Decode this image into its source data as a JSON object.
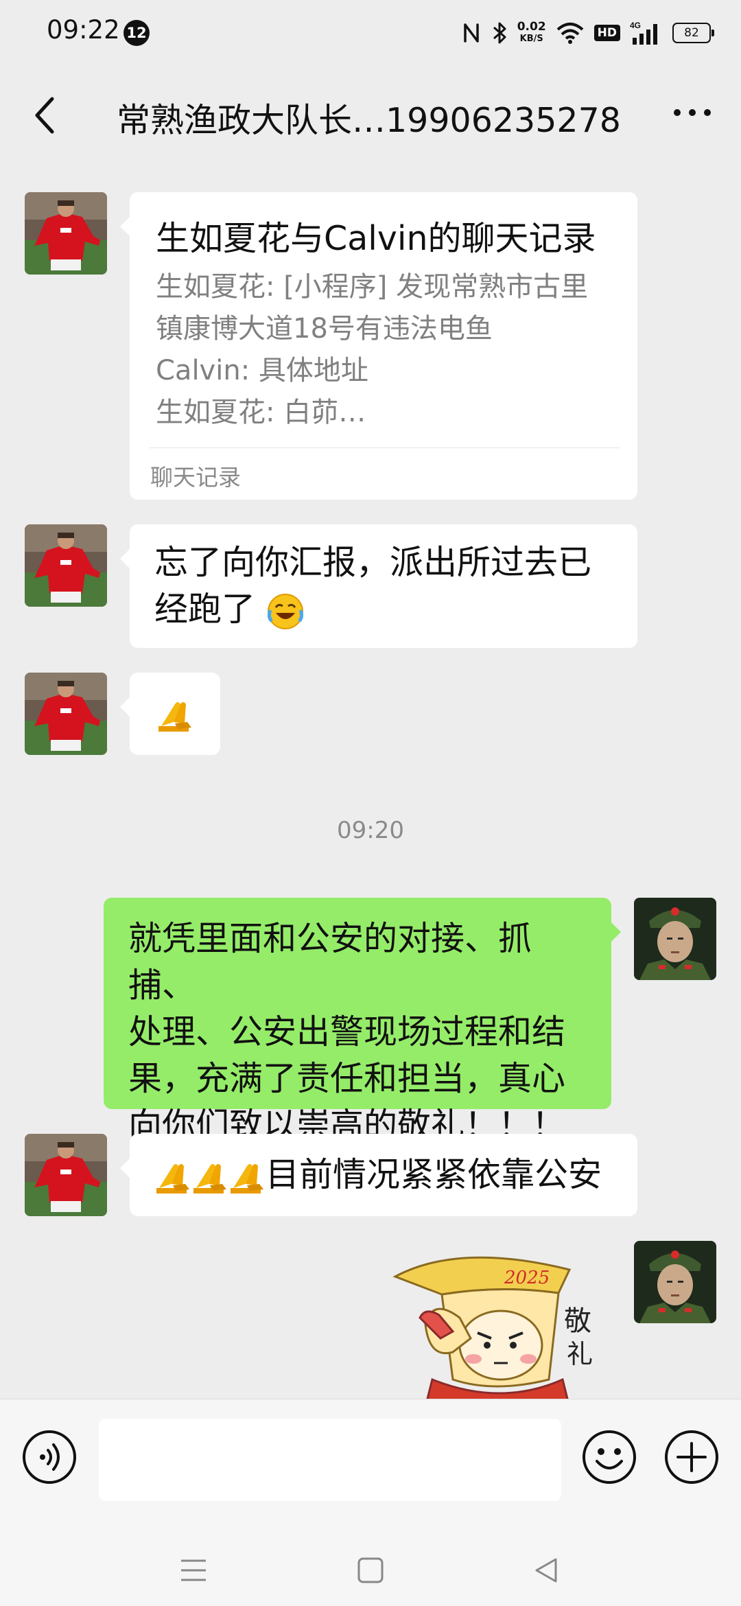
{
  "status_bar": {
    "time": "09:22",
    "notification_count": "12",
    "net_speed_value": "0.02",
    "net_speed_unit": "KB/S",
    "hd_label": "HD",
    "network_label": "4G",
    "battery_level": "82",
    "icons": [
      "nfc-icon",
      "bluetooth-icon",
      "wifi-icon",
      "signal-icon"
    ]
  },
  "header": {
    "title": "常熟渔政大队长…19906235278",
    "back_icon": "chevron-left-icon",
    "more_icon": "more-icon"
  },
  "messages": {
    "record": {
      "title": "生如夏花与Calvin的聊天记录",
      "lines": [
        "生如夏花: [小程序] 发现常熟市古里",
        "镇康博大道18号有违法电鱼",
        "Calvin: 具体地址",
        "生如夏花: 白茆…"
      ],
      "footer": "聊天记录"
    },
    "msg2_lines": [
      "忘了向你汇报，派出所过去已",
      "经跑了"
    ],
    "timestamp": "09:20",
    "msg4_lines": [
      "就凭里面和公安的对接、抓捕、",
      "处理、公安出警现场过程和结",
      "果，充满了责任和担当，真心",
      "向你们致以崇高的敬礼！！！"
    ],
    "msg5_text": "目前情况紧紧依靠公安",
    "sticker": {
      "year": "2025",
      "char1": "敬",
      "char2": "礼"
    }
  },
  "colors": {
    "background": "#ededed",
    "incoming_bubble": "#ffffff",
    "outgoing_bubble": "#95ec69",
    "secondary_text": "#808080"
  },
  "input_bar": {
    "voice_icon": "voice-icon",
    "emoji_icon": "emoji-icon",
    "plus_icon": "plus-icon",
    "placeholder": ""
  },
  "nav_bar": {
    "icons": [
      "menu-icon",
      "home-icon",
      "back-icon"
    ]
  }
}
